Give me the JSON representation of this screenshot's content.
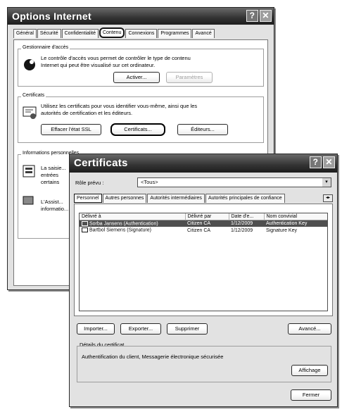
{
  "options_window": {
    "title": "Options Internet",
    "help_glyph": "?",
    "close_glyph": "✕",
    "tabs": [
      {
        "label": "Général"
      },
      {
        "label": "Sécurité"
      },
      {
        "label": "Confidentialité"
      },
      {
        "label": "Contenu"
      },
      {
        "label": "Connexions"
      },
      {
        "label": "Programmes"
      },
      {
        "label": "Avancé"
      }
    ],
    "access_group": {
      "label": "Gestionnaire d'accès",
      "description": "Le contrôle d'accès vous permet de contrôler le type de contenu Internet qui peut être visualisé sur cet ordinateur.",
      "activate_button": "Activer...",
      "settings_button": "Paramètres"
    },
    "certificates_group": {
      "label": "Certificats",
      "description": "Utilisez les certificats pour vous identifier vous-même, ainsi que les autorités de certification et les éditeurs.",
      "clear_ssl_button": "Effacer l'état SSL",
      "certificates_button": "Certificats...",
      "publishers_button": "Éditeurs..."
    },
    "personal_group": {
      "label": "Informations personnelles",
      "line1": "La saisie...",
      "line2": "entrées",
      "line3": "certains",
      "line4": "L'Assist...",
      "line5": "informatio..."
    }
  },
  "cert_dialog": {
    "title": "Certificats",
    "help_glyph": "?",
    "close_glyph": "✕",
    "purpose_label": "Rôle prévu :",
    "purpose_value": "<Tous>",
    "tabs": [
      {
        "label": "Personnel"
      },
      {
        "label": "Autres personnes"
      },
      {
        "label": "Autorités intermédiaires"
      },
      {
        "label": "Autorités principales de confiance"
      }
    ],
    "columns": [
      "Délivré à",
      "Délivré par",
      "Date d'e...",
      "Nom convivial"
    ],
    "rows": [
      {
        "issued_to": "Sorba Jansens (Authentication)",
        "issued_by": "Citizen CA",
        "expiry": "1/12/2009",
        "friendly_name": "Authentication Key",
        "selected": true
      },
      {
        "issued_to": "Bartbol Siemens (Signature)",
        "issued_by": "Citizen CA",
        "expiry": "1/12/2009",
        "friendly_name": "Signature Key",
        "selected": false
      }
    ],
    "import_button": "Importer...",
    "export_button": "Exporter...",
    "remove_button": "Supprimer",
    "advanced_button": "Avancé...",
    "details_label": "Détails du certificat",
    "details_text": "Authentification du client, Messagerie électronique sécurisée",
    "view_button": "Affichage",
    "close_button": "Fermer"
  }
}
